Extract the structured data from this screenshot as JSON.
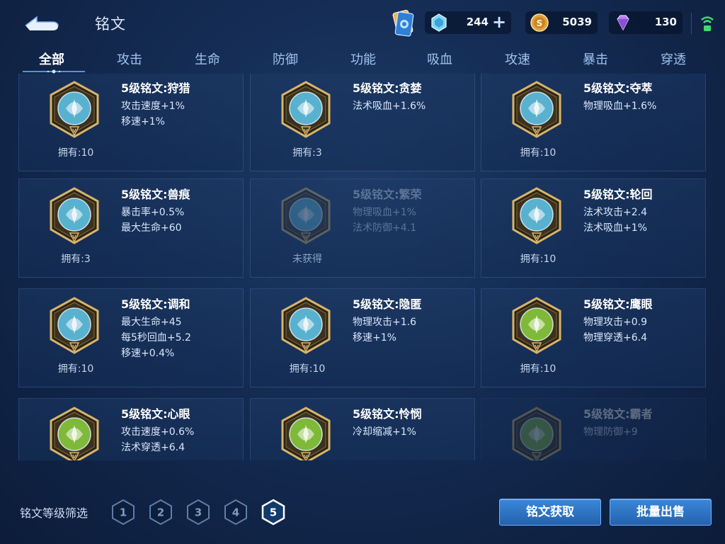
{
  "header": {
    "title": "铭文",
    "currencies": {
      "diamond": "244",
      "coin": "5039",
      "gem": "130"
    }
  },
  "tabs": [
    {
      "label": "全部",
      "active": true
    },
    {
      "label": "攻击"
    },
    {
      "label": "生命"
    },
    {
      "label": "防御"
    },
    {
      "label": "功能"
    },
    {
      "label": "吸血"
    },
    {
      "label": "攻速"
    },
    {
      "label": "暴击"
    },
    {
      "label": "穿透"
    }
  ],
  "inscriptions": [
    {
      "name": "5级铭文:狩猎",
      "stats": [
        "攻击速度+1%",
        "移速+1%"
      ],
      "owned": "拥有:10",
      "icon": "hunt-emblem-icon",
      "color": "#5ec8ee"
    },
    {
      "name": "5级铭文:贪婪",
      "stats": [
        "法术吸血+1.6%"
      ],
      "owned": "拥有:3",
      "icon": "greed-emblem-icon",
      "color": "#5ec8ee"
    },
    {
      "name": "5级铭文:夺萃",
      "stats": [
        "物理吸血+1.6%"
      ],
      "owned": "拥有:10",
      "icon": "seize-emblem-icon",
      "color": "#5ec8ee"
    },
    {
      "name": "5级铭文:兽痕",
      "stats": [
        "暴击率+0.5%",
        "最大生命+60"
      ],
      "owned": "拥有:3",
      "icon": "beast-mark-emblem-icon",
      "color": "#5ec8ee"
    },
    {
      "name": "5级铭文:繁荣",
      "stats": [
        "物理吸血+1%",
        "法术防御+4.1"
      ],
      "owned": "未获得",
      "icon": "prosperity-emblem-icon",
      "color": "#5ec8ee"
    },
    {
      "name": "5级铭文:轮回",
      "stats": [
        "法术攻击+2.4",
        "法术吸血+1%"
      ],
      "owned": "拥有:10",
      "icon": "cycle-emblem-icon",
      "color": "#5ec8ee"
    },
    {
      "name": "5级铭文:调和",
      "stats": [
        "最大生命+45",
        "每5秒回血+5.2",
        "移速+0.4%"
      ],
      "owned": "拥有:10",
      "icon": "harmony-emblem-icon",
      "color": "#5ec8ee"
    },
    {
      "name": "5级铭文:隐匿",
      "stats": [
        "物理攻击+1.6",
        "移速+1%"
      ],
      "owned": "拥有:10",
      "icon": "stealth-emblem-icon",
      "color": "#5ec8ee"
    },
    {
      "name": "5级铭文:鹰眼",
      "stats": [
        "物理攻击+0.9",
        "物理穿透+6.4"
      ],
      "owned": "拥有:10",
      "icon": "eagle-eye-emblem-icon",
      "color": "#8bd13e"
    },
    {
      "name": "5级铭文:心眼",
      "stats": [
        "攻击速度+0.6%",
        "法术穿透+6.4"
      ],
      "owned": "",
      "icon": "mind-eye-emblem-icon",
      "color": "#8bd13e"
    },
    {
      "name": "5级铭文:怜悯",
      "stats": [
        "冷却缩减+1%"
      ],
      "owned": "",
      "icon": "mercy-emblem-icon",
      "color": "#8bd13e"
    },
    {
      "name": "5级铭文:霸者",
      "stats": [
        "物理防御+9"
      ],
      "owned": "",
      "icon": "overlord-emblem-icon",
      "color": "#8bd13e"
    }
  ],
  "footer": {
    "filter_label": "铭文等级筛选",
    "levels": [
      "1",
      "2",
      "3",
      "4",
      "5"
    ],
    "selected_level": "5",
    "get_button": "铭文获取",
    "sell_button": "批量出售"
  },
  "colors": {
    "accent": "#3b87d9",
    "blue_emblem": "#5ec8ee",
    "green_emblem": "#8bd13e",
    "gold_frame": "#d8b46a"
  }
}
